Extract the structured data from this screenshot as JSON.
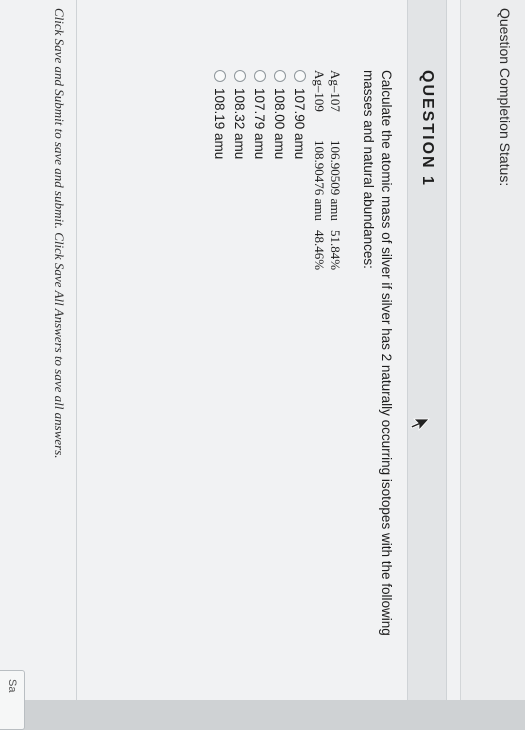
{
  "status": {
    "label": "Question Completion Status:"
  },
  "question": {
    "title": "QUESTION 1",
    "prompt": "Calculate the atomic mass of silver if silver has 2 naturally occurring isotopes with the following masses and natural abundances:",
    "isotopes": [
      {
        "name": "Ag–107",
        "mass": "106.90509 amu",
        "abundance": "51.84%"
      },
      {
        "name": "Ag–109",
        "mass": "108.90476 amu",
        "abundance": "48.46%"
      }
    ],
    "options": [
      "107.90 amu",
      "108.00 amu",
      "107.79 amu",
      "108.32 amu",
      "108.19 amu"
    ]
  },
  "footer": {
    "instruction": "Click Save and Submit to save and submit. Click Save All Answers to save all answers."
  },
  "buttons": {
    "save_label": "Sa"
  },
  "icons": {
    "cursor": "cursor-arrow-icon"
  }
}
